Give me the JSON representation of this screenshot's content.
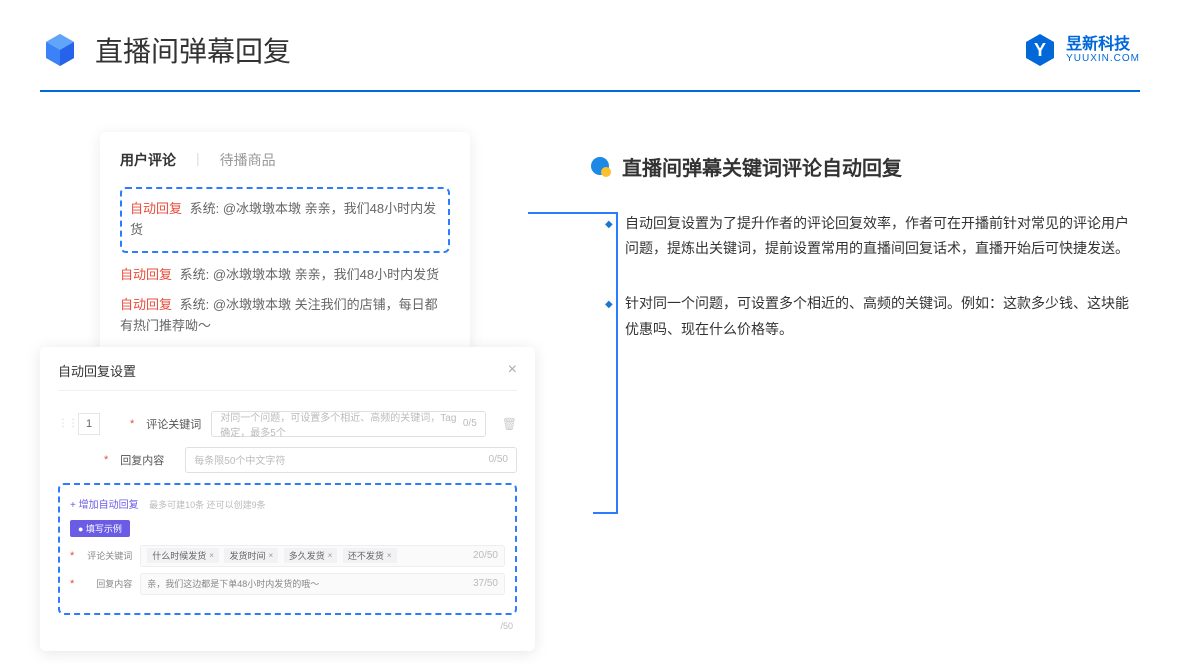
{
  "header": {
    "title": "直播间弹幕回复",
    "brand_cn": "昱新科技",
    "brand_en": "YUUXIN.COM"
  },
  "comments": {
    "tabs": {
      "active": "用户评论",
      "inactive": "待播商品"
    },
    "highlighted": {
      "tag": "自动回复",
      "text": "系统: @冰墩墩本墩 亲亲，我们48小时内发货"
    },
    "rows": [
      {
        "tag": "自动回复",
        "text": "系统: @冰墩墩本墩 亲亲，我们48小时内发货"
      },
      {
        "tag": "自动回复",
        "text": "系统: @冰墩墩本墩 关注我们的店铺，每日都有热门推荐呦～"
      }
    ]
  },
  "settings": {
    "title": "自动回复设置",
    "num": "1",
    "keyword_label": "评论关键词",
    "keyword_placeholder": "对同一个问题，可设置多个相近、高频的关键词，Tag确定，最多5个",
    "keyword_count": "0/5",
    "content_label": "回复内容",
    "content_placeholder": "每条限50个中文字符",
    "content_count": "0/50",
    "add_link": "+ 增加自动回复",
    "add_hint": "最多可建10条 还可以创建9条",
    "example_badge": "● 填写示例",
    "ex_keyword_label": "评论关键词",
    "ex_tags": [
      "什么时候发货",
      "发货时间",
      "多久发货",
      "还不发货"
    ],
    "ex_keyword_count": "20/50",
    "ex_content_label": "回复内容",
    "ex_content_value": "亲，我们这边都是下单48小时内发货的哦～",
    "ex_content_count": "37/50",
    "bottom_count": "/50"
  },
  "right": {
    "section_title": "直播间弹幕关键词评论自动回复",
    "bullets": [
      "自动回复设置为了提升作者的评论回复效率，作者可在开播前针对常见的评论用户问题，提炼出关键词，提前设置常用的直播间回复话术，直播开始后可快捷发送。",
      "针对同一个问题，可设置多个相近的、高频的关键词。例如：这款多少钱、这块能优惠吗、现在什么价格等。"
    ]
  }
}
